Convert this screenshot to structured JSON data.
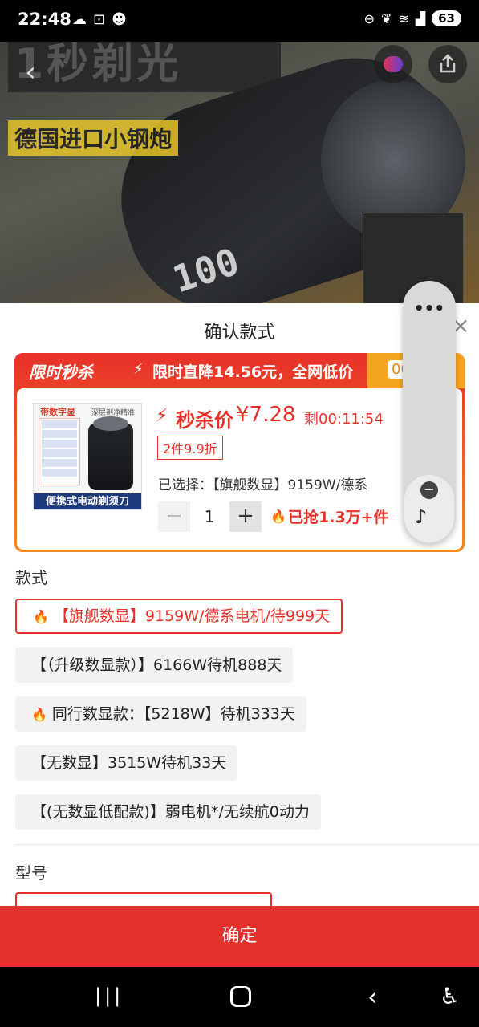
{
  "status_bar": {
    "time": "22:48",
    "left_icons": [
      "cloud-icon",
      "scan-icon",
      "cat-icon"
    ],
    "right_icons": [
      "dnd-icon",
      "leaf-icon",
      "wifi-icon",
      "signal-icon"
    ],
    "battery": "63"
  },
  "hero": {
    "headline": "1秒剃光",
    "subtitle": "德国进口小钢炮",
    "display_digits": "100",
    "back_glyph": "‹"
  },
  "sheet": {
    "title": "确认款式",
    "close_glyph": "×"
  },
  "product": {
    "flash_tag": "限时秒杀",
    "flash_text": "限时直降14.56元，全网低价",
    "timer": "00",
    "price_label": "秒杀价",
    "price": "¥7.28",
    "remaining": "剩00:11:54",
    "bundle_tag": "2件9.9折",
    "selected": "已选择：【旗舰数显】9159W/德系",
    "quantity": "1",
    "minus_glyph": "−",
    "plus_glyph": "+",
    "sold": "已抢1.3万+件",
    "image_badge": "带数字显",
    "image_top_text": "深层剃净精准",
    "image_caption": "便携式电动剃须刀"
  },
  "float_widget": {
    "menu_glyph": "•••",
    "minus_glyph": "−",
    "audio_glyph": "♪"
  },
  "style_section": {
    "label": "款式",
    "options": [
      {
        "label": "【旗舰数显】9159W/德系电机/待999天",
        "hot": true,
        "selected": true
      },
      {
        "label": "【（升级数显款）】6166W待机888天",
        "hot": false,
        "selected": false
      },
      {
        "label": "同行数显款：【5218W】待机333天",
        "hot": true,
        "selected": false
      },
      {
        "label": "【无数显】3515W待机33天",
        "hot": false,
        "selected": false
      },
      {
        "label": "【(无数显低配款)】弱电机*/无续航0动力",
        "hot": false,
        "selected": false
      }
    ]
  },
  "model_section": {
    "label": "型号"
  },
  "confirm_label": "确定",
  "nav": {
    "recents": "|||",
    "back": "‹",
    "accessibility": "♿"
  },
  "colors": {
    "accent": "#e5312b",
    "flash_orange": "#f5a521"
  }
}
